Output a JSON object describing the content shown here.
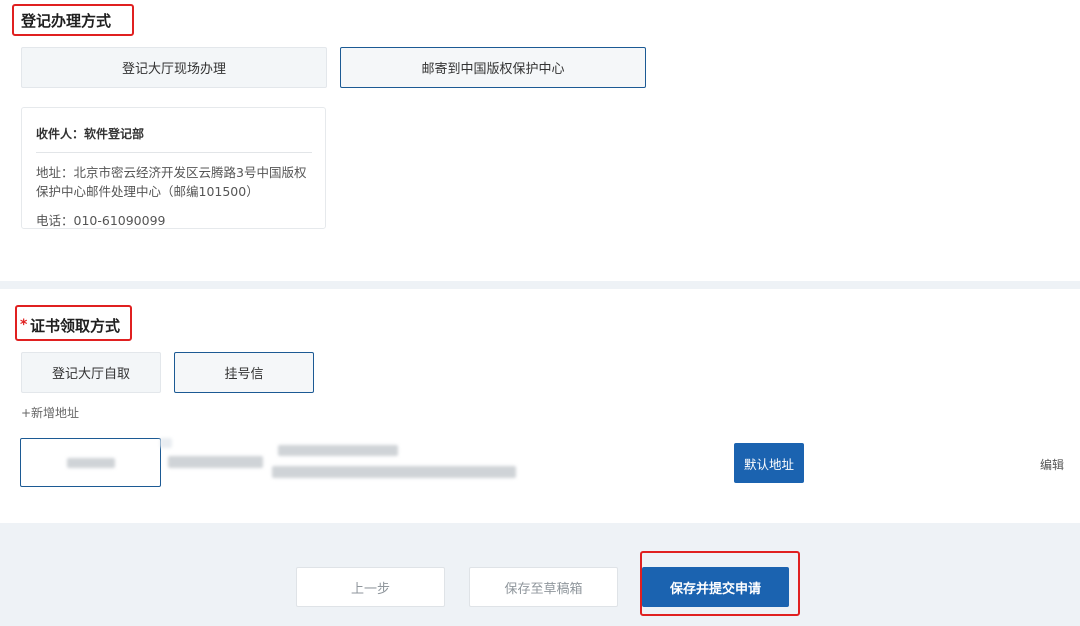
{
  "registration_method": {
    "title": "登记办理方式",
    "options": [
      "登记大厅现场办理",
      "邮寄到中国版权保护中心"
    ],
    "selected": "邮寄到中国版权保护中心",
    "card": {
      "recipient": "收件人：软件登记部",
      "address": "地址：北京市密云经济开发区云腾路3号中国版权保护中心邮件处理中心（邮编101500）",
      "phone": "电话：010-61090099"
    }
  },
  "certificate_method": {
    "required_mark": "*",
    "title": "证书领取方式",
    "options": [
      "登记大厅自取",
      "挂号信"
    ],
    "selected": "挂号信",
    "add_address": "+新增地址",
    "address_row": {
      "default_label": "默认地址",
      "edit_label": "编辑"
    }
  },
  "footer": {
    "prev": "上一步",
    "save_draft": "保存至草稿箱",
    "submit": "保存并提交申请"
  },
  "colors": {
    "primary": "#1b63b0",
    "highlight": "#e02020",
    "selected_border": "#1c5a94"
  }
}
